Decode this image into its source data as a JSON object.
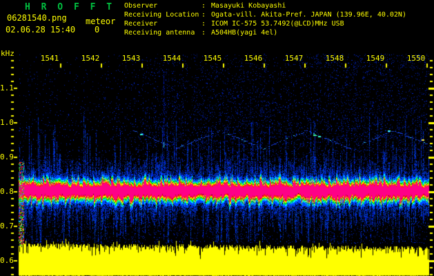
{
  "window": {
    "description": "HROFFT 10-minute radio meteor observation spectrogram output image"
  },
  "header": {
    "app_title": "H R O F F T",
    "filename": "06281540.png",
    "mode": "meteor",
    "datetime": "02.06.28 15:40",
    "echo_count": "0",
    "info_rows": [
      {
        "label": "Observer",
        "sep": ":",
        "value": "Masayuki Kobayashi"
      },
      {
        "label": "Receiving Location",
        "sep": ":",
        "value": "Ogata-vill. Akita-Pref. JAPAN (139.96E, 40.02N)"
      },
      {
        "label": "Receiver",
        "sep": ":",
        "value": "ICOM IC-575 53.7492(@LCD)MHz USB"
      },
      {
        "label": "Receiving antenna",
        "sep": ":",
        "value": "A504HB(yagi 4el)"
      }
    ]
  },
  "colors": {
    "background": "#000000",
    "title_green": "#00c040",
    "text_yellow": "#ffff00",
    "band_core_magenta": "#ff0087",
    "band_red": "#ff1e00",
    "band_yellow": "#ffe800",
    "band_green": "#00dd00",
    "band_cyan": "#00eaff",
    "noise_blue": "#0030c0",
    "saturated_yellow": "#ffff00",
    "tick_yellow": "#ffff00"
  },
  "chart_data": {
    "type": "heatmap",
    "subtype": "radio-spectrogram",
    "ylabel": "kHz",
    "y_ticks": [
      "1.1",
      "1.0",
      "0.9",
      "0.8",
      "0.7",
      "0.6"
    ],
    "y_minor_tick_khz": 0.02,
    "y_range_khz": [
      0.59,
      1.19
    ],
    "x_ticks": [
      "1541",
      "1542",
      "1543",
      "1544",
      "1545",
      "1546",
      "1547",
      "1548",
      "1549",
      "1550"
    ],
    "x_axis_unit": "time (hhmm, JST)",
    "x_start_min": 1540.0,
    "features": {
      "carrier_band": {
        "center_khz": 0.8,
        "core_halfwidth_khz": 0.02,
        "fringe_khz": 0.05,
        "spans_minutes": [
          1540,
          1550.1
        ],
        "description": "continuous direct-carrier trace: magenta core with red/yellow/green/cyan/blue fringes, spiky amplitude modulation, blue vertical tails above and below"
      },
      "saturated_low_band": {
        "top_khz": 0.645,
        "description": "overdriven solid yellow region below ~0.65 kHz with ragged notched upper edge"
      },
      "zigzag_interference": {
        "khz_low": 0.925,
        "khz_high": 0.977,
        "period_min": 2.13,
        "first_peak_min": 1542.78,
        "end_min": 1550.17,
        "description": "faint dotted triangle-wave drifting tone across right two-thirds of plot"
      },
      "vertical_event": {
        "time_min": 1543.53,
        "khz_span": [
          0.66,
          1.15
        ],
        "description": "faint broadband vertical streak (weak meteor/ionospheric event)"
      },
      "startup_column": {
        "time_min": 1540.0,
        "khz_span": [
          0.64,
          0.885
        ],
        "description": "multicolour speckle column at extreme left edge of plot"
      },
      "highlight_dots": [
        {
          "time_min": 1542.95,
          "khz": 0.968,
          "color": "#33ffdd"
        },
        {
          "time_min": 1547.22,
          "khz": 0.966,
          "color": "#44ff88"
        },
        {
          "time_min": 1547.33,
          "khz": 0.962,
          "color": "#33ffcc"
        },
        {
          "time_min": 1549.05,
          "khz": 0.978,
          "color": "#44ffff"
        },
        {
          "time_min": 1549.88,
          "khz": 0.952,
          "color": "#ffee44"
        }
      ]
    }
  }
}
